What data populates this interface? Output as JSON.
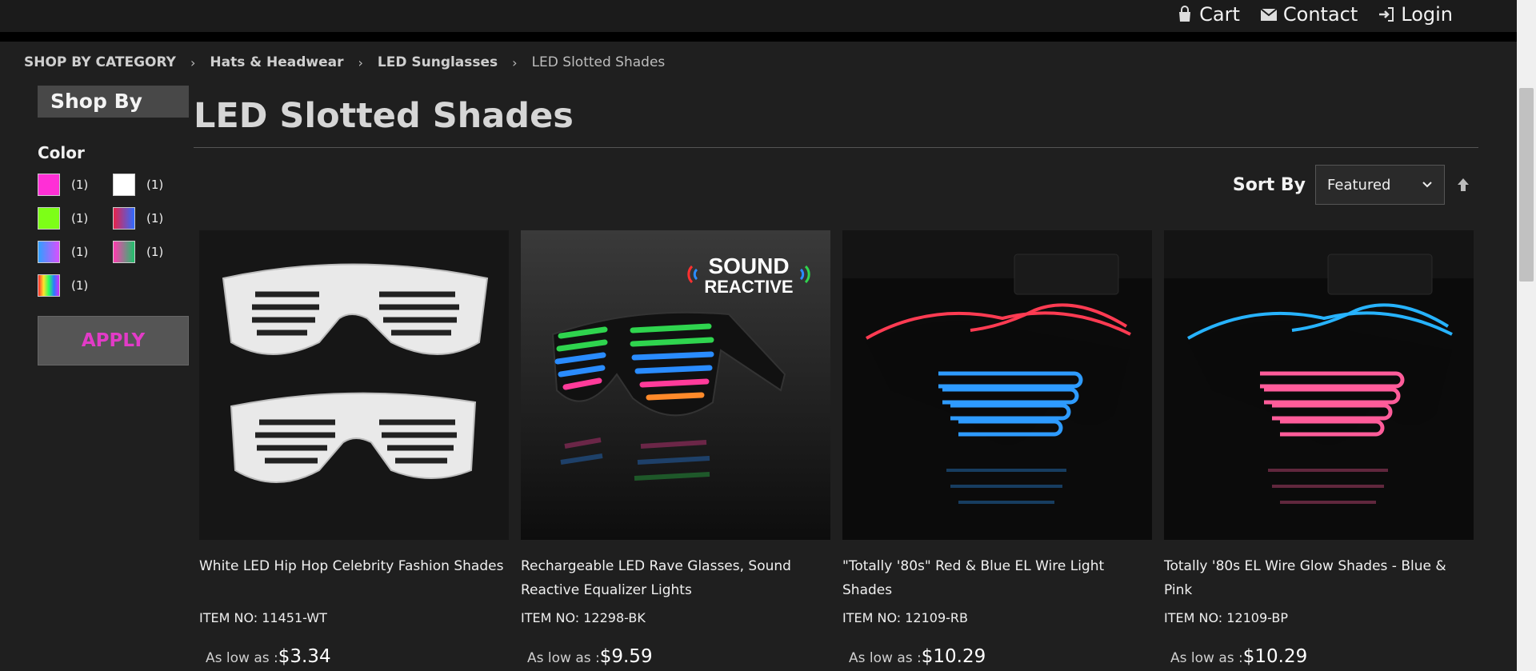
{
  "header": {
    "links": [
      {
        "label": "Cart",
        "icon": "cart-icon"
      },
      {
        "label": "Contact",
        "icon": "envelope-icon"
      },
      {
        "label": "Login",
        "icon": "sign-in-icon"
      }
    ]
  },
  "breadcrumb": [
    {
      "label": "SHOP BY CATEGORY"
    },
    {
      "label": "Hats & Headwear"
    },
    {
      "label": "LED Sunglasses"
    },
    {
      "label": "LED Slotted Shades"
    }
  ],
  "sidebar": {
    "shop_by": "Shop By",
    "color_title": "Color",
    "swatches": [
      {
        "count": "(1)",
        "color": "#ff2fd6"
      },
      {
        "count": "(1)",
        "color": "#ffffff"
      },
      {
        "count": "(1)",
        "color": "#7dff17"
      },
      {
        "count": "(1)",
        "color": "linear-gradient(90deg,#e8234a,#2f6bff)"
      },
      {
        "count": "(1)",
        "color": "linear-gradient(90deg,#2fa0ff,#d94fff)"
      },
      {
        "count": "(1)",
        "color": "linear-gradient(90deg,#ff3bb0,#1fc16b)"
      },
      {
        "count": "(1)",
        "color": "linear-gradient(90deg,#ff2a2a,#ffe42a,#2aff5c,#2a7bff,#d22aff)"
      }
    ],
    "apply_label": "APPLY"
  },
  "page_title": "LED Slotted Shades",
  "sort": {
    "label": "Sort By",
    "selected": "Featured"
  },
  "products": [
    {
      "name": "White LED Hip Hop Celebrity Fashion Shades",
      "item_no": "ITEM NO: 11451-WT",
      "price_prefix": "As low as :",
      "price": "$3.34"
    },
    {
      "name": "Rechargeable LED Rave Glasses, Sound Reactive Equalizer Lights",
      "item_no": "ITEM NO: 12298-BK",
      "price_prefix": "As low as :",
      "price": "$9.59",
      "badge_line1": "SOUND",
      "badge_line2": "REACTIVE"
    },
    {
      "name": "\"Totally '80s\" Red & Blue EL Wire Light Shades",
      "item_no": "ITEM NO: 12109-RB",
      "price_prefix": "As low as :",
      "price": "$10.29"
    },
    {
      "name": "Totally '80s EL Wire Glow Shades - Blue & Pink",
      "item_no": "ITEM NO: 12109-BP",
      "price_prefix": "As low as :",
      "price": "$10.29"
    }
  ]
}
